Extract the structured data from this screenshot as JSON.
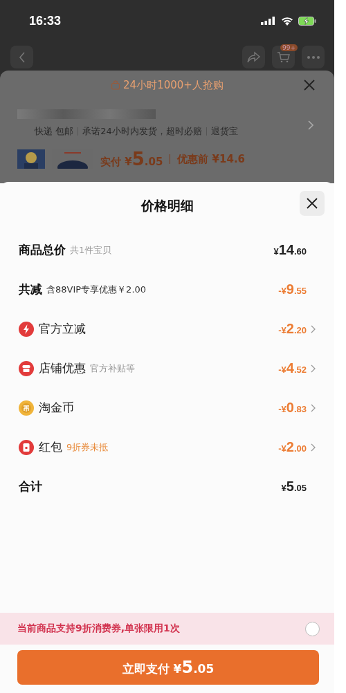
{
  "status_bar": {
    "time": "16:33"
  },
  "nav": {
    "cart_badge": "99+"
  },
  "behind_sheet": {
    "hot_label": "24小时1000+人抢购",
    "services": [
      "快递 包邮",
      "承诺24小时内发货，超时必赔",
      "退货宝"
    ],
    "paid_label": "实付",
    "paid_amount": "¥5.05",
    "before_label": "优惠前 ¥14.6"
  },
  "sheet": {
    "title": "价格明细",
    "rows": [
      {
        "kind": "total",
        "label": "商品总价",
        "note": "共1件宝贝",
        "note_highlight": false,
        "amount": "¥14.60",
        "discount": false,
        "link": false
      },
      {
        "kind": "total",
        "label": "共减",
        "note": "含88VIP专享优惠￥2.00",
        "note_highlight": false,
        "amount": "-¥9.55",
        "discount": true,
        "link": false
      },
      {
        "kind": "bolt",
        "label": "官方立减",
        "amount": "-¥2.20",
        "discount": true,
        "link": true
      },
      {
        "kind": "shop",
        "label": "店铺优惠",
        "note": "官方补贴等",
        "note_highlight": false,
        "amount": "-¥4.52",
        "discount": true,
        "link": true
      },
      {
        "kind": "coin",
        "label": "淘金币",
        "amount": "-¥0.83",
        "discount": true,
        "link": true
      },
      {
        "kind": "packet",
        "label": "红包",
        "note": "9折券未抵",
        "note_highlight": true,
        "amount": "-¥2.00",
        "discount": true,
        "link": true
      },
      {
        "kind": "total",
        "label": "合计",
        "amount": "¥5.05",
        "discount": false,
        "link": false
      }
    ],
    "coupon": {
      "text": "当前商品支持9折消费券,单张限用1次",
      "checked": false
    },
    "pay_button": {
      "label": "立即支付",
      "amount": "¥5.05"
    }
  }
}
